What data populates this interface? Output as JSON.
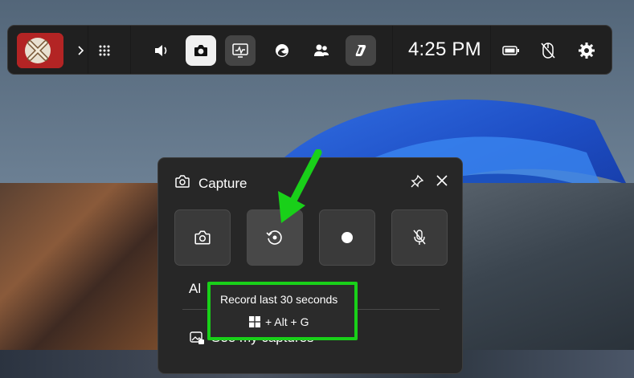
{
  "gamebar": {
    "time": "4:25 PM",
    "icons": [
      "game-avatar",
      "chevron-right-icon",
      "widget-menu-icon",
      "volume-icon",
      "capture-icon",
      "performance-icon",
      "edge-icon",
      "social-icon",
      "copilot-icon",
      "battery-icon",
      "mouse-off-icon",
      "settings-icon"
    ],
    "selected": "capture-icon"
  },
  "capture_panel": {
    "title": "Capture",
    "buttons": [
      "screenshot",
      "record-last-30-seconds",
      "start-recording",
      "mic-off"
    ],
    "partial_label": "Al",
    "see_captures_label": "See my captures"
  },
  "tooltip": {
    "title": "Record last 30 seconds",
    "shortcut": "+ Alt + G",
    "highlight_color": "#19d019"
  },
  "colors": {
    "panel_bg": "#272727",
    "gamebar_bg": "#202020",
    "annotation_green": "#19d019"
  }
}
